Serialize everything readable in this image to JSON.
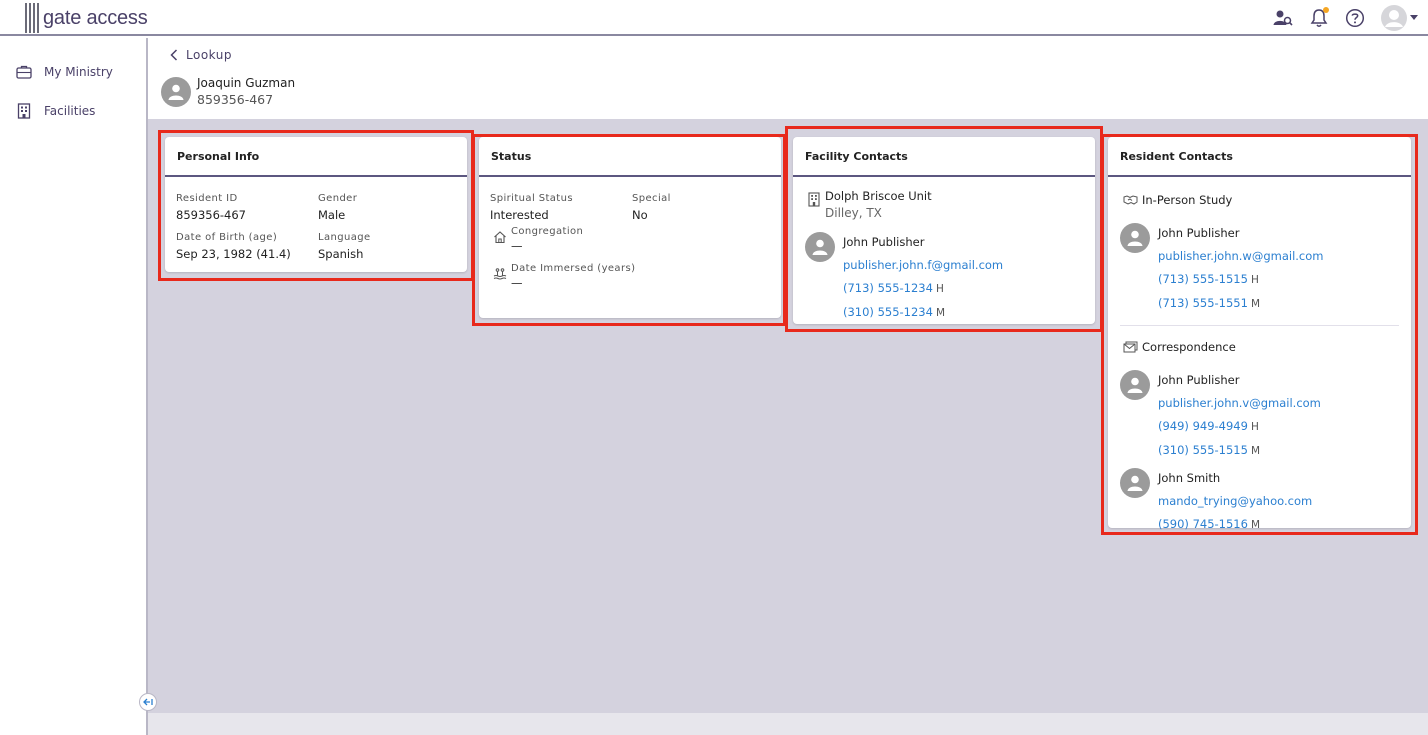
{
  "app": {
    "logo_text": "gate access"
  },
  "header": {
    "icons": [
      "user-search-icon",
      "bell-icon",
      "help-icon",
      "user-avatar-icon"
    ],
    "notification_dot_color": "#f5a623"
  },
  "sidebar": {
    "items": [
      {
        "label": "My Ministry",
        "icon": "briefcase-icon"
      },
      {
        "label": "Facilities",
        "icon": "building-icon"
      }
    ]
  },
  "breadcrumb": {
    "back_label": "Lookup"
  },
  "resident": {
    "name": "Joaquin Guzman",
    "id": "859356-467"
  },
  "personal_info": {
    "title": "Personal Info",
    "resident_id_label": "Resident ID",
    "resident_id": "859356-467",
    "gender_label": "Gender",
    "gender": "Male",
    "dob_label": "Date of Birth (age)",
    "dob": "Sep 23, 1982 (41.4)",
    "language_label": "Language",
    "language": "Spanish"
  },
  "status": {
    "title": "Status",
    "spiritual_label": "Spiritual Status",
    "spiritual": "Interested",
    "special_label": "Special",
    "special": "No",
    "congregation_label": "Congregation",
    "congregation": "—",
    "immersed_label": "Date Immersed (years)",
    "immersed": "—"
  },
  "facility_contacts": {
    "title": "Facility Contacts",
    "facility_name": "Dolph Briscoe Unit",
    "facility_location": "Dilley, TX",
    "contact": {
      "name": "John Publisher",
      "email": "publisher.john.f@gmail.com",
      "phones": [
        {
          "number": "(713) 555-1234",
          "type": "H"
        },
        {
          "number": "(310) 555-1234",
          "type": "M"
        }
      ]
    }
  },
  "resident_contacts": {
    "title": "Resident Contacts",
    "in_person": {
      "label": "In-Person Study",
      "contacts": [
        {
          "name": "John Publisher",
          "email": "publisher.john.w@gmail.com",
          "phones": [
            {
              "number": "(713) 555-1515",
              "type": "H"
            },
            {
              "number": "(713) 555-1551",
              "type": "M"
            }
          ]
        }
      ]
    },
    "correspondence": {
      "label": "Correspondence",
      "contacts": [
        {
          "name": "John Publisher",
          "email": "publisher.john.v@gmail.com",
          "phones": [
            {
              "number": "(949) 949-4949",
              "type": "H"
            },
            {
              "number": "(310) 555-1515",
              "type": "M"
            }
          ]
        },
        {
          "name": "John Smith",
          "email": "mando_trying@yahoo.com",
          "phones": [
            {
              "number": "(590) 745-1516",
              "type": "M"
            }
          ]
        }
      ]
    }
  },
  "colors": {
    "accent": "#4a4168",
    "link": "#2b7fd0",
    "highlight": "#e8291c",
    "content_bg": "#d4d2de"
  }
}
